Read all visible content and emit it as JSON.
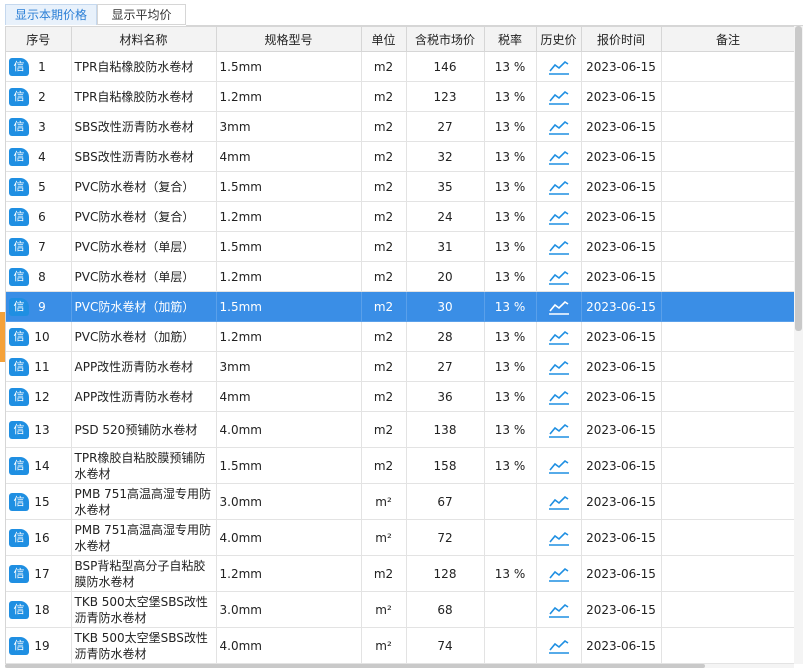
{
  "tabs": [
    "显示本期价格",
    "显示平均价"
  ],
  "columns": [
    "序号",
    "材料名称",
    "规格型号",
    "单位",
    "含税市场价",
    "税率",
    "历史价",
    "报价时间",
    "备注"
  ],
  "badge_label": "信",
  "history_icon": "trend-chart-icon",
  "accent_color": "#1f8fe2",
  "selected_row_color": "#3a8ee6",
  "rows": [
    {
      "no": "1",
      "name": "TPR自粘橡胶防水卷材",
      "spec": "1.5mm",
      "unit": "m2",
      "price": "146",
      "tax": "13 %",
      "date": "2023-06-15",
      "remark": ""
    },
    {
      "no": "2",
      "name": "TPR自粘橡胶防水卷材",
      "spec": "1.2mm",
      "unit": "m2",
      "price": "123",
      "tax": "13 %",
      "date": "2023-06-15",
      "remark": ""
    },
    {
      "no": "3",
      "name": "SBS改性沥青防水卷材",
      "spec": "3mm",
      "unit": "m2",
      "price": "27",
      "tax": "13 %",
      "date": "2023-06-15",
      "remark": ""
    },
    {
      "no": "4",
      "name": "SBS改性沥青防水卷材",
      "spec": "4mm",
      "unit": "m2",
      "price": "32",
      "tax": "13 %",
      "date": "2023-06-15",
      "remark": ""
    },
    {
      "no": "5",
      "name": "PVC防水卷材（复合）",
      "spec": "1.5mm",
      "unit": "m2",
      "price": "35",
      "tax": "13 %",
      "date": "2023-06-15",
      "remark": ""
    },
    {
      "no": "6",
      "name": "PVC防水卷材（复合）",
      "spec": "1.2mm",
      "unit": "m2",
      "price": "24",
      "tax": "13 %",
      "date": "2023-06-15",
      "remark": ""
    },
    {
      "no": "7",
      "name": "PVC防水卷材（单层）",
      "spec": "1.5mm",
      "unit": "m2",
      "price": "31",
      "tax": "13 %",
      "date": "2023-06-15",
      "remark": ""
    },
    {
      "no": "8",
      "name": "PVC防水卷材（单层）",
      "spec": "1.2mm",
      "unit": "m2",
      "price": "20",
      "tax": "13 %",
      "date": "2023-06-15",
      "remark": ""
    },
    {
      "no": "9",
      "name": "PVC防水卷材（加筋）",
      "spec": "1.5mm",
      "unit": "m2",
      "price": "30",
      "tax": "13 %",
      "date": "2023-06-15",
      "remark": "",
      "selected": true
    },
    {
      "no": "10",
      "name": "PVC防水卷材（加筋）",
      "spec": "1.2mm",
      "unit": "m2",
      "price": "28",
      "tax": "13 %",
      "date": "2023-06-15",
      "remark": ""
    },
    {
      "no": "11",
      "name": "APP改性沥青防水卷材",
      "spec": "3mm",
      "unit": "m2",
      "price": "27",
      "tax": "13 %",
      "date": "2023-06-15",
      "remark": ""
    },
    {
      "no": "12",
      "name": "APP改性沥青防水卷材",
      "spec": "4mm",
      "unit": "m2",
      "price": "36",
      "tax": "13 %",
      "date": "2023-06-15",
      "remark": ""
    },
    {
      "no": "13",
      "name": "PSD 520预铺防水卷材",
      "spec": "4.0mm",
      "unit": "m2",
      "price": "138",
      "tax": "13 %",
      "date": "2023-06-15",
      "remark": ""
    },
    {
      "no": "14",
      "name": "TPR橡胶自粘胶膜预铺防水卷材",
      "spec": "1.5mm",
      "unit": "m2",
      "price": "158",
      "tax": "13 %",
      "date": "2023-06-15",
      "remark": ""
    },
    {
      "no": "15",
      "name": "PMB 751高温高湿专用防水卷材",
      "spec": "3.0mm",
      "unit": "m²",
      "price": "67",
      "tax": "",
      "date": "2023-06-15",
      "remark": ""
    },
    {
      "no": "16",
      "name": "PMB 751高温高湿专用防水卷材",
      "spec": "4.0mm",
      "unit": "m²",
      "price": "72",
      "tax": "",
      "date": "2023-06-15",
      "remark": ""
    },
    {
      "no": "17",
      "name": "BSP背粘型高分子自粘胶膜防水卷材",
      "spec": "1.2mm",
      "unit": "m2",
      "price": "128",
      "tax": "13 %",
      "date": "2023-06-15",
      "remark": ""
    },
    {
      "no": "18",
      "name": "TKB 500太空堡SBS改性沥青防水卷材",
      "spec": "3.0mm",
      "unit": "m²",
      "price": "68",
      "tax": "",
      "date": "2023-06-15",
      "remark": ""
    },
    {
      "no": "19",
      "name": "TKB 500太空堡SBS改性沥青防水卷材",
      "spec": "4.0mm",
      "unit": "m²",
      "price": "74",
      "tax": "",
      "date": "2023-06-15",
      "remark": ""
    }
  ]
}
